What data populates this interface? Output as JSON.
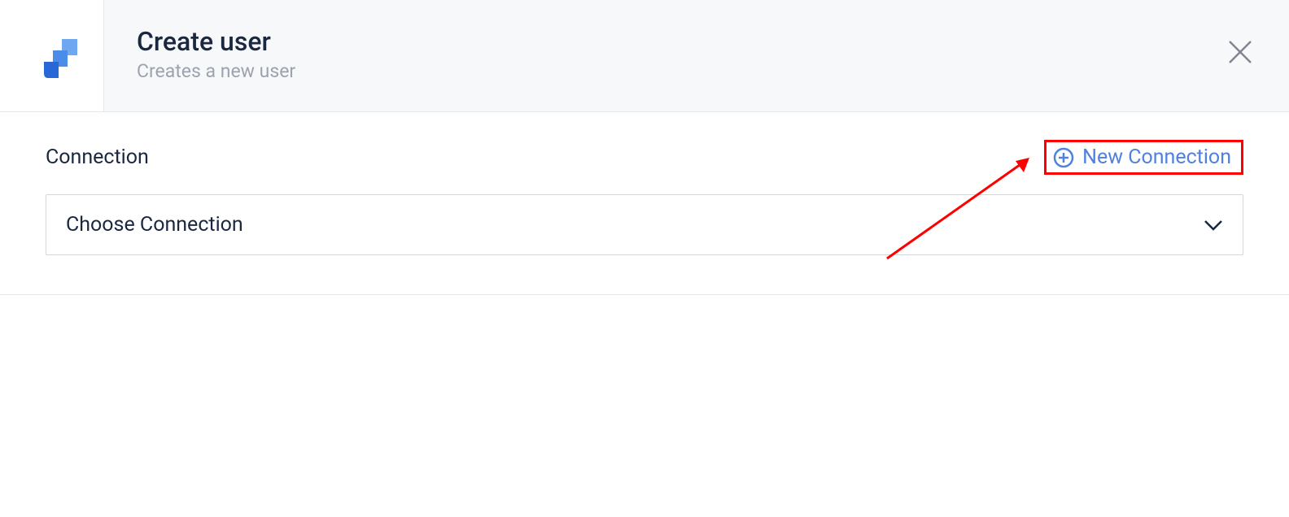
{
  "header": {
    "title": "Create user",
    "subtitle": "Creates a new user"
  },
  "connection": {
    "label": "Connection",
    "new_connection_label": "New Connection",
    "dropdown_placeholder": "Choose Connection"
  }
}
